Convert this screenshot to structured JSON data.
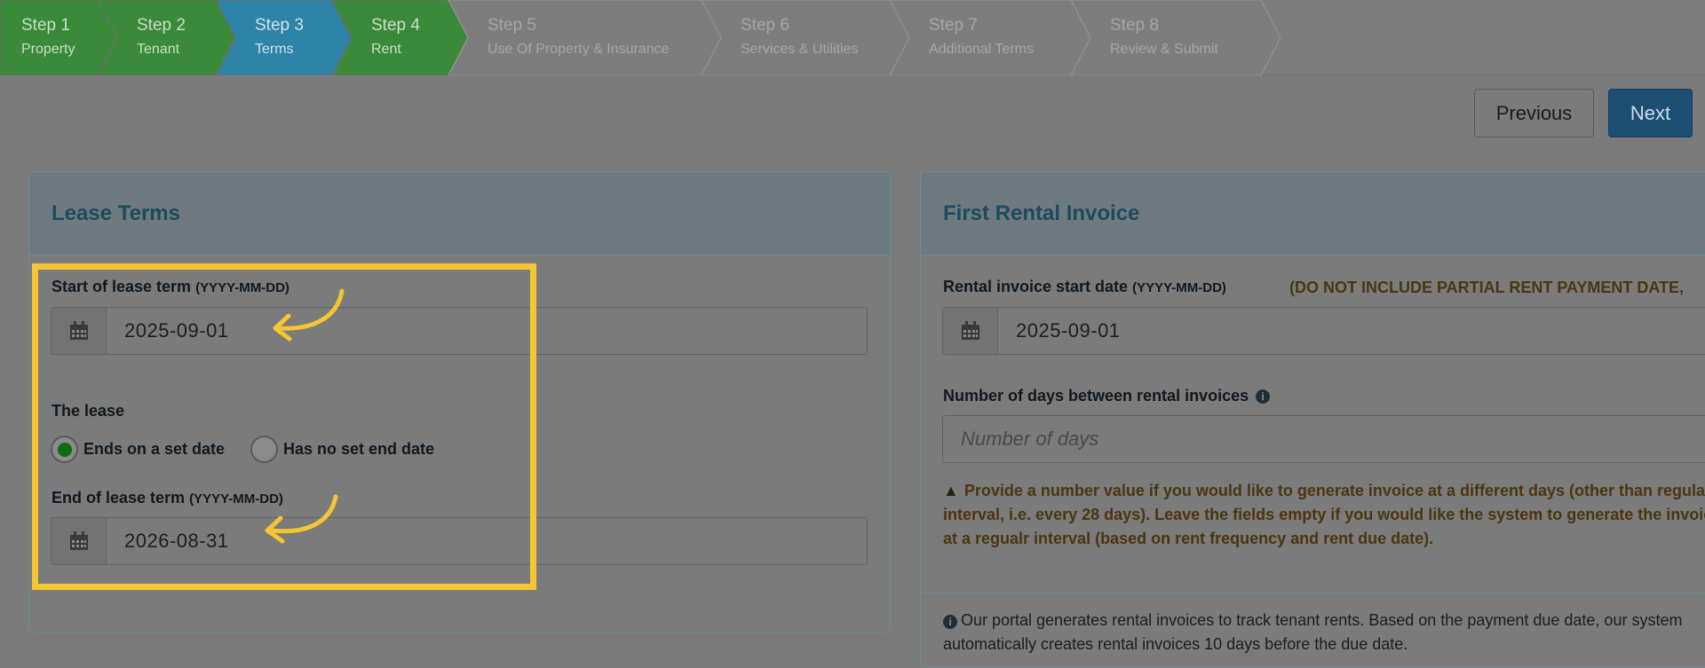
{
  "steps": [
    {
      "title": "Step 1",
      "subtitle": "Property",
      "state": "done"
    },
    {
      "title": "Step 2",
      "subtitle": "Tenant",
      "state": "done"
    },
    {
      "title": "Step 3",
      "subtitle": "Terms",
      "state": "active"
    },
    {
      "title": "Step 4",
      "subtitle": "Rent",
      "state": "done"
    },
    {
      "title": "Step 5",
      "subtitle": "Use Of Property & Insurance",
      "state": "todo"
    },
    {
      "title": "Step 6",
      "subtitle": "Services & Utilities",
      "state": "todo"
    },
    {
      "title": "Step 7",
      "subtitle": "Additional Terms",
      "state": "todo"
    },
    {
      "title": "Step 8",
      "subtitle": "Review & Submit",
      "state": "todo"
    }
  ],
  "nav": {
    "previous_label": "Previous",
    "next_label": "Next"
  },
  "lease_terms": {
    "heading": "Lease Terms",
    "start_label": "Start of lease term",
    "start_format": "(YYYY-MM-DD)",
    "start_value": "2025-09-01",
    "lease_label": "The lease",
    "option_set_date": "Ends on a set date",
    "option_no_end": "Has no set end date",
    "selected_option": "Ends on a set date",
    "end_label": "End of lease term",
    "end_format": "(YYYY-MM-DD)",
    "end_value": "2026-08-31"
  },
  "first_invoice": {
    "heading": "First Rental Invoice",
    "start_label": "Rental invoice start date",
    "start_format": "(YYYY-MM-DD)",
    "start_hint": "(DO NOT INCLUDE PARTIAL RENT PAYMENT DATE,",
    "start_value": "2025-09-01",
    "days_label": "Number of days between rental invoices",
    "days_placeholder": "Number of days",
    "warning": "Provide a number value if you would like to generate invoice at a different days (other than regular interval, i.e. every 28 days). Leave the fields empty if you would like the system to generate the invoice at a regualr interval (based on rent frequency and rent due date).",
    "info": "Our portal generates rental invoices to track tenant rents. Based on the payment due date, our system automatically creates rental invoices 10 days before the due date."
  },
  "colors": {
    "step_done": "#3b8a3a",
    "step_active": "#2d84a6",
    "highlight": "#f5c533",
    "next_button": "#1d4e73",
    "radio_selected": "#0f6a10"
  }
}
